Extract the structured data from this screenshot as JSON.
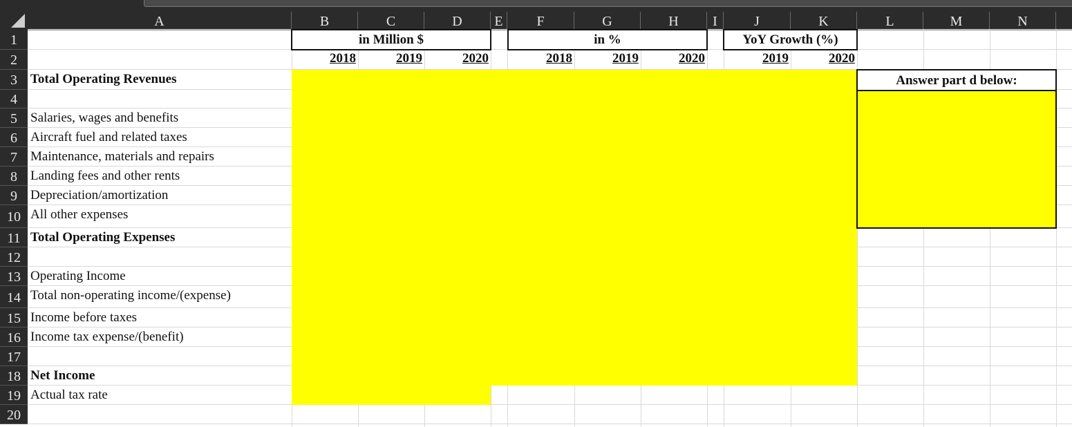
{
  "columns": [
    "A",
    "B",
    "C",
    "D",
    "E",
    "F",
    "G",
    "H",
    "I",
    "J",
    "K",
    "L",
    "M",
    "N"
  ],
  "rows": [
    "1",
    "2",
    "3",
    "4",
    "5",
    "6",
    "7",
    "8",
    "9",
    "10",
    "11",
    "12",
    "13",
    "14",
    "15",
    "16",
    "17",
    "18",
    "19",
    "20"
  ],
  "groups": {
    "million": "in Million $",
    "percent": "in %",
    "yoy": "YoY Growth (%)"
  },
  "years": {
    "million": [
      "2018",
      "2019",
      "2020"
    ],
    "percent": [
      "2018",
      "2019",
      "2020"
    ],
    "yoy": [
      "2019",
      "2020"
    ]
  },
  "labels": {
    "r3": "Total Operating Revenues",
    "r5": "Salaries, wages and benefits",
    "r6": "Aircraft fuel and related taxes",
    "r7": "Maintenance, materials and repairs",
    "r8": "Landing fees and other rents",
    "r9": "Depreciation/amortization",
    "r10": "All other expenses",
    "r11": "Total Operating Expenses",
    "r13": "Operating Income",
    "r14": "Total non-operating income/(expense)",
    "r15": "Income before taxes",
    "r16": "Income tax expense/(benefit)",
    "r18": "Net Income",
    "r19": "Actual tax rate"
  },
  "answer": {
    "title": "Answer part d below:",
    "value": ""
  },
  "colors": {
    "input_fill": "#ffff00",
    "header_bg": "#2b2b2b",
    "gridline": "#d9d9d9"
  }
}
